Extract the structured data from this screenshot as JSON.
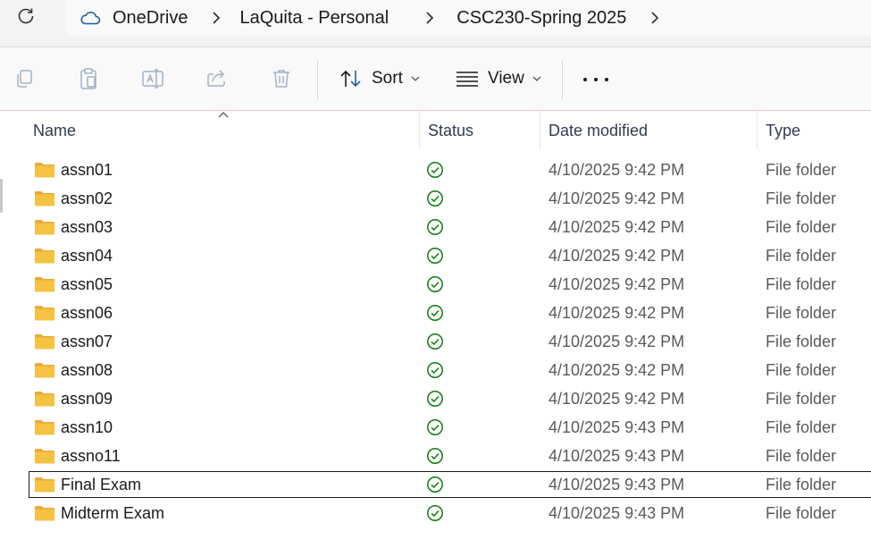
{
  "breadcrumb": {
    "items": [
      "OneDrive",
      "LaQuita - Personal",
      "CSC230-Spring 2025"
    ]
  },
  "toolbar": {
    "sort_label": "Sort",
    "view_label": "View"
  },
  "columns": {
    "name": "Name",
    "status": "Status",
    "date": "Date modified",
    "type": "Type"
  },
  "files": [
    {
      "name": "assn01",
      "date": "4/10/2025 9:42 PM",
      "type": "File folder",
      "status": "available",
      "selected": false
    },
    {
      "name": "assn02",
      "date": "4/10/2025 9:42 PM",
      "type": "File folder",
      "status": "available",
      "selected": false
    },
    {
      "name": "assn03",
      "date": "4/10/2025 9:42 PM",
      "type": "File folder",
      "status": "available",
      "selected": false
    },
    {
      "name": "assn04",
      "date": "4/10/2025 9:42 PM",
      "type": "File folder",
      "status": "available",
      "selected": false
    },
    {
      "name": "assn05",
      "date": "4/10/2025 9:42 PM",
      "type": "File folder",
      "status": "available",
      "selected": false
    },
    {
      "name": "assn06",
      "date": "4/10/2025 9:42 PM",
      "type": "File folder",
      "status": "available",
      "selected": false
    },
    {
      "name": "assn07",
      "date": "4/10/2025 9:42 PM",
      "type": "File folder",
      "status": "available",
      "selected": false
    },
    {
      "name": "assn08",
      "date": "4/10/2025 9:42 PM",
      "type": "File folder",
      "status": "available",
      "selected": false
    },
    {
      "name": "assn09",
      "date": "4/10/2025 9:42 PM",
      "type": "File folder",
      "status": "available",
      "selected": false
    },
    {
      "name": "assn10",
      "date": "4/10/2025 9:43 PM",
      "type": "File folder",
      "status": "available",
      "selected": false
    },
    {
      "name": "assno11",
      "date": "4/10/2025 9:43 PM",
      "type": "File folder",
      "status": "available",
      "selected": false
    },
    {
      "name": "Final Exam",
      "date": "4/10/2025 9:43 PM",
      "type": "File folder",
      "status": "available",
      "selected": true
    },
    {
      "name": "Midterm Exam",
      "date": "4/10/2025 9:43 PM",
      "type": "File folder",
      "status": "available",
      "selected": false
    }
  ],
  "colors": {
    "status_ok": "#107c10",
    "folder": "#f5c342",
    "disabled_icon": "#9fb3c8"
  }
}
